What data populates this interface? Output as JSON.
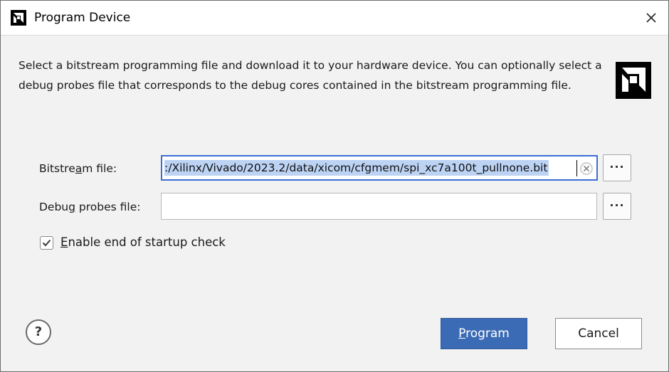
{
  "window": {
    "title": "Program Device",
    "icon": "amd-logo-icon",
    "close": "close-icon"
  },
  "description": "Select a bitstream programming file and download it to your hardware device. You can optionally select a debug probes file that corresponds to the debug cores contained in the bitstream programming file.",
  "bitstream": {
    "label_before": "Bitstre",
    "label_mnemonic": "a",
    "label_after": "m file:",
    "value": ":/Xilinx/Vivado/2023.2/data/xicom/cfgmem/spi_xc7a100t_pullnone.bit",
    "browse": "···",
    "clear_icon": "clear-icon"
  },
  "debug": {
    "label_before": "Debu",
    "label_mnemonic": "g",
    "label_after": " probes file:",
    "value": "",
    "browse": "···"
  },
  "startup_check": {
    "mnemonic": "E",
    "label_rest": "nable end of startup check",
    "checked": true
  },
  "help": "?",
  "buttons": {
    "program_mnemonic": "P",
    "program_rest": "rogram",
    "cancel": "Cancel"
  },
  "colors": {
    "accent": "#3b6bb5",
    "selection": "#bcd3f4",
    "focus_border": "#3b6fd4"
  }
}
